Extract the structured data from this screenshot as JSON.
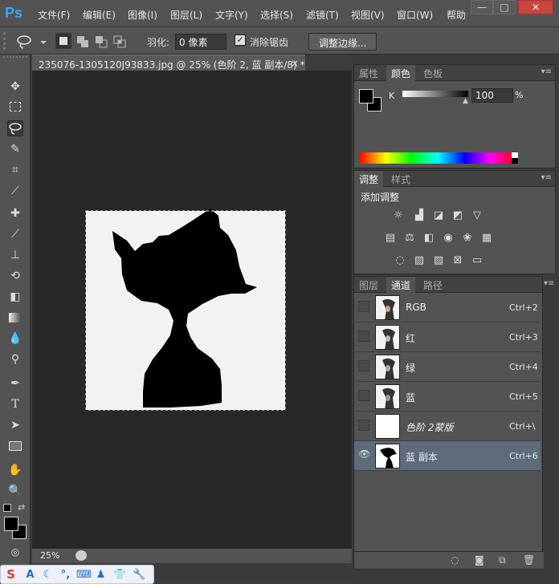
{
  "app": {
    "logo": "Ps"
  },
  "menu": [
    "文件(F)",
    "编辑(E)",
    "图像(I)",
    "图层(L)",
    "文字(Y)",
    "选择(S)",
    "滤镜(T)",
    "视图(V)",
    "窗口(W)",
    "帮助"
  ],
  "window_controls": {
    "minimize": "—",
    "maximize": "□",
    "close": "✕"
  },
  "options": {
    "feather_label": "羽化:",
    "feather_value": "0 像素",
    "antialias_label": "消除锯齿",
    "antialias_checked": true,
    "refine_edge_button": "调整边缘..."
  },
  "document": {
    "tab_title": "235076-1305120J93833.jpg @ 25% (色阶 2, 蓝 副本/8) *",
    "zoom": "25%"
  },
  "color_panel": {
    "tabs": [
      "属性",
      "颜色",
      "色板"
    ],
    "active_tab": "颜色",
    "channel_label": "K",
    "value": "100",
    "unit": "%",
    "fg_color": "#000000",
    "bg_color": "#000000"
  },
  "adjustments_panel": {
    "tabs": [
      "调整",
      "样式"
    ],
    "active_tab": "调整",
    "heading": "添加调整",
    "icons": [
      [
        "brightness-icon",
        "levels-icon",
        "curves-icon",
        "exposure-icon",
        "vibrance-icon"
      ],
      [
        "hue-saturation-icon",
        "color-balance-icon",
        "black-white-icon",
        "photo-filter-icon",
        "channel-mixer-icon",
        "color-lookup-icon"
      ],
      [
        "invert-icon",
        "posterize-icon",
        "threshold-icon",
        "selective-color-icon",
        "gradient-map-icon"
      ]
    ]
  },
  "channels_panel": {
    "tabs": [
      "图层",
      "通道",
      "路径"
    ],
    "active_tab": "通道",
    "rows": [
      {
        "name": "RGB",
        "shortcut": "Ctrl+2",
        "visible": false,
        "selected": false,
        "italic": false,
        "thumb": "photo"
      },
      {
        "name": "红",
        "shortcut": "Ctrl+3",
        "visible": false,
        "selected": false,
        "italic": false,
        "thumb": "photo"
      },
      {
        "name": "绿",
        "shortcut": "Ctrl+4",
        "visible": false,
        "selected": false,
        "italic": false,
        "thumb": "photo"
      },
      {
        "name": "蓝",
        "shortcut": "Ctrl+5",
        "visible": false,
        "selected": false,
        "italic": false,
        "thumb": "photo"
      },
      {
        "name": "色阶 2蒙版",
        "shortcut": "Ctrl+\\",
        "visible": false,
        "selected": false,
        "italic": true,
        "thumb": "white"
      },
      {
        "name": "蓝 副本",
        "shortcut": "Ctrl+6",
        "visible": true,
        "selected": true,
        "italic": false,
        "thumb": "silhouette"
      }
    ]
  },
  "ime_toolbar": {
    "logo": "S",
    "items": [
      "A",
      "☾",
      "°,",
      "⌨",
      "♟",
      "👕",
      "🔧"
    ]
  }
}
